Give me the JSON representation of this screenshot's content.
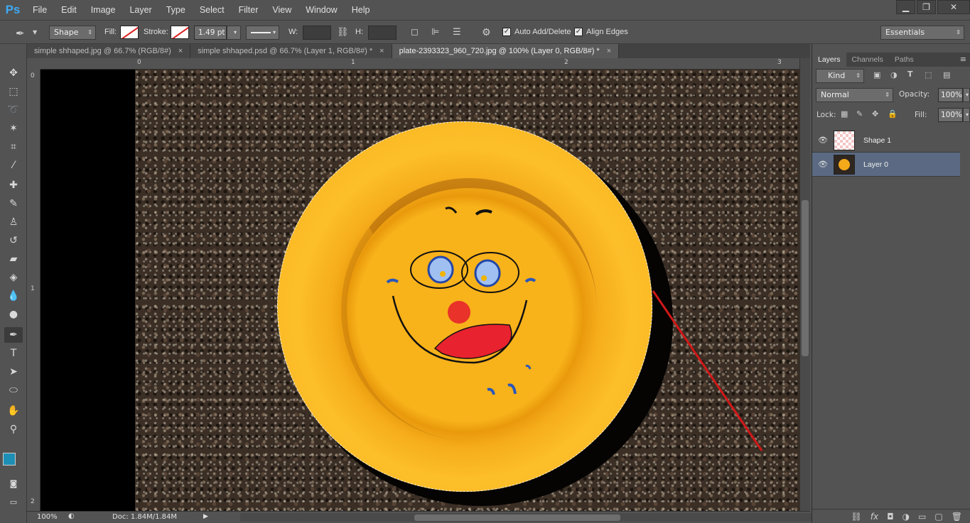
{
  "app": {
    "logo": "Ps",
    "menu": [
      "File",
      "Edit",
      "Image",
      "Layer",
      "Type",
      "Select",
      "Filter",
      "View",
      "Window",
      "Help"
    ],
    "window_controls": {
      "minimize": "▁",
      "restore": "❐",
      "close": "✕"
    }
  },
  "options": {
    "mode": "Shape",
    "fill_label": "Fill:",
    "stroke_label": "Stroke:",
    "stroke_width": "1.49 pt",
    "w_label": "W:",
    "h_label": "H:",
    "auto_add_delete": "Auto Add/Delete",
    "align_edges": "Align Edges",
    "workspace": "Essentials"
  },
  "tabs": [
    {
      "label": "simple shhaped.jpg @ 66.7% (RGB/8#)",
      "close": "×"
    },
    {
      "label": "simple shhaped.psd @ 66.7% (Layer 1, RGB/8#) *",
      "close": "×"
    },
    {
      "label": "plate-2393323_960_720.jpg @ 100% (Layer 0, RGB/8#) *",
      "close": "×"
    }
  ],
  "rulers": {
    "top": [
      "0",
      "1",
      "2",
      "3"
    ],
    "left": [
      "0",
      "1",
      "2"
    ]
  },
  "status": {
    "zoom": "100%",
    "doc": "Doc: 1.84M/1.84M"
  },
  "panel": {
    "tabs": [
      "Layers",
      "Channels",
      "Paths"
    ],
    "filter": "Kind",
    "blend_mode": "Normal",
    "opacity_label": "Opacity:",
    "opacity": "100%",
    "lock_label": "Lock:",
    "fill_label": "Fill:",
    "fill": "100%",
    "layers": [
      {
        "name": "Shape 1",
        "selected": false
      },
      {
        "name": "Layer 0",
        "selected": true
      }
    ]
  },
  "colors": {
    "foreground": "#1e8fb4",
    "background": "#000000"
  }
}
